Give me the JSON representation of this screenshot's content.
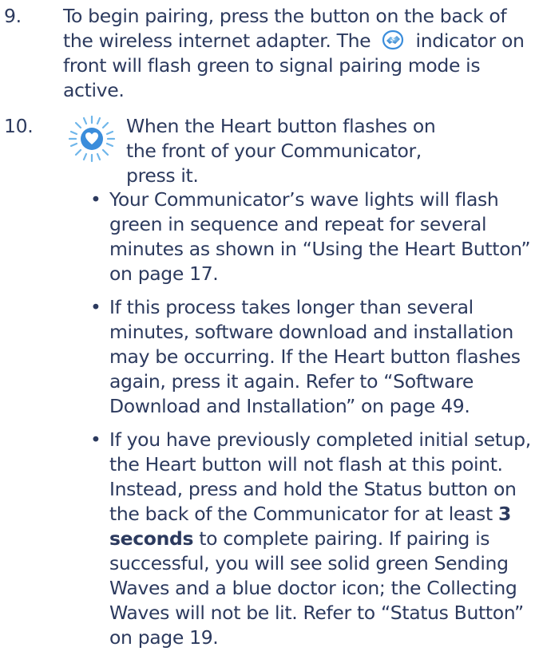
{
  "step9": {
    "number": "9.",
    "text_before_icon": "To begin pairing, press the button on the back of the wireless internet adapter. The",
    "icon": "pairing-handshake-icon",
    "text_after_icon": "indicator on front will flash green to signal pairing mode is active."
  },
  "step10": {
    "number": "10.",
    "icon": "heart-button-icon",
    "text": "When the Heart button flashes on the front of your Communicator, press it."
  },
  "bullets": [
    {
      "text": "Your Communicator’s wave lights will flash green in sequence and repeat for several minutes as shown in “Using the Heart Button” on page 17."
    },
    {
      "text": "If this process takes longer than several minutes, software download and installation may be occurring. If the Heart button flashes again, press it again. Refer to “Software Download and Installation” on page 49."
    },
    {
      "text_before_bold": "If you have previously completed initial setup, the Heart button will not flash at this point. Instead, press and hold the Status button on the back of the Communicator for at least",
      "bold": "3 seconds",
      "text_after_bold": "to complete pairing. If pairing is successful, you will see solid green Sending Waves and a blue doctor icon; the Collecting Waves will not be lit. Refer to “Status Button” on page 19."
    }
  ],
  "colors": {
    "text": "#2c3a5e",
    "icon_blue": "#3b8ddb",
    "icon_light": "#6fb6ea"
  }
}
